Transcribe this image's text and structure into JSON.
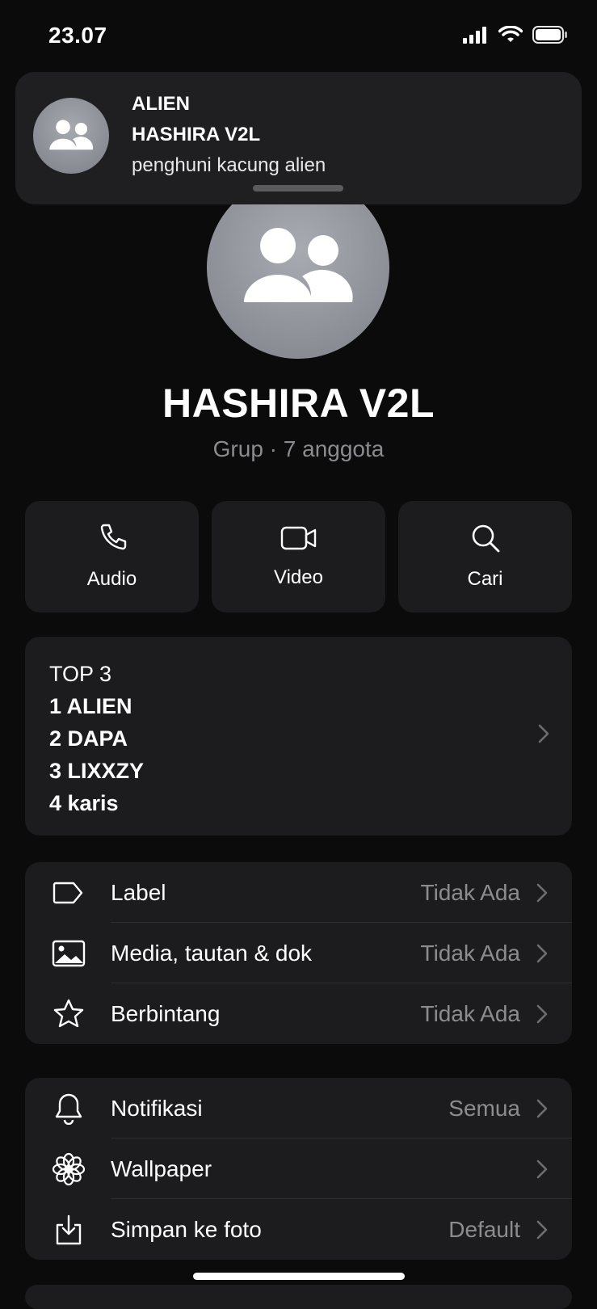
{
  "status_bar": {
    "time": "23.07"
  },
  "notification": {
    "sender": "ALIEN",
    "group": "HASHIRA V2L",
    "message": "penghuni kacung alien"
  },
  "group": {
    "name": "HASHIRA V2L",
    "subtitle": "Grup · 7 anggota"
  },
  "actions": [
    {
      "label": "Audio",
      "icon": "phone-icon"
    },
    {
      "label": "Video",
      "icon": "video-icon"
    },
    {
      "label": "Cari",
      "icon": "search-icon"
    }
  ],
  "description": {
    "title": "TOP 3",
    "lines": [
      "1 ALIEN",
      "2 DAPA",
      "3 LIXXZY",
      "4 karis"
    ]
  },
  "settings_group1": [
    {
      "label": "Label",
      "value": "Tidak Ada",
      "icon": "label-tag-icon"
    },
    {
      "label": "Media, tautan & dok",
      "value": "Tidak Ada",
      "icon": "image-icon"
    },
    {
      "label": "Berbintang",
      "value": "Tidak Ada",
      "icon": "star-icon"
    }
  ],
  "settings_group2": [
    {
      "label": "Notifikasi",
      "value": "Semua",
      "icon": "bell-icon"
    },
    {
      "label": "Wallpaper",
      "value": "",
      "icon": "flower-icon"
    },
    {
      "label": "Simpan ke foto",
      "value": "Default",
      "icon": "save-download-icon"
    }
  ],
  "colors": {
    "background": "#0b0b0b",
    "card": "#1c1c1e",
    "secondary_text": "#8c8c90"
  }
}
